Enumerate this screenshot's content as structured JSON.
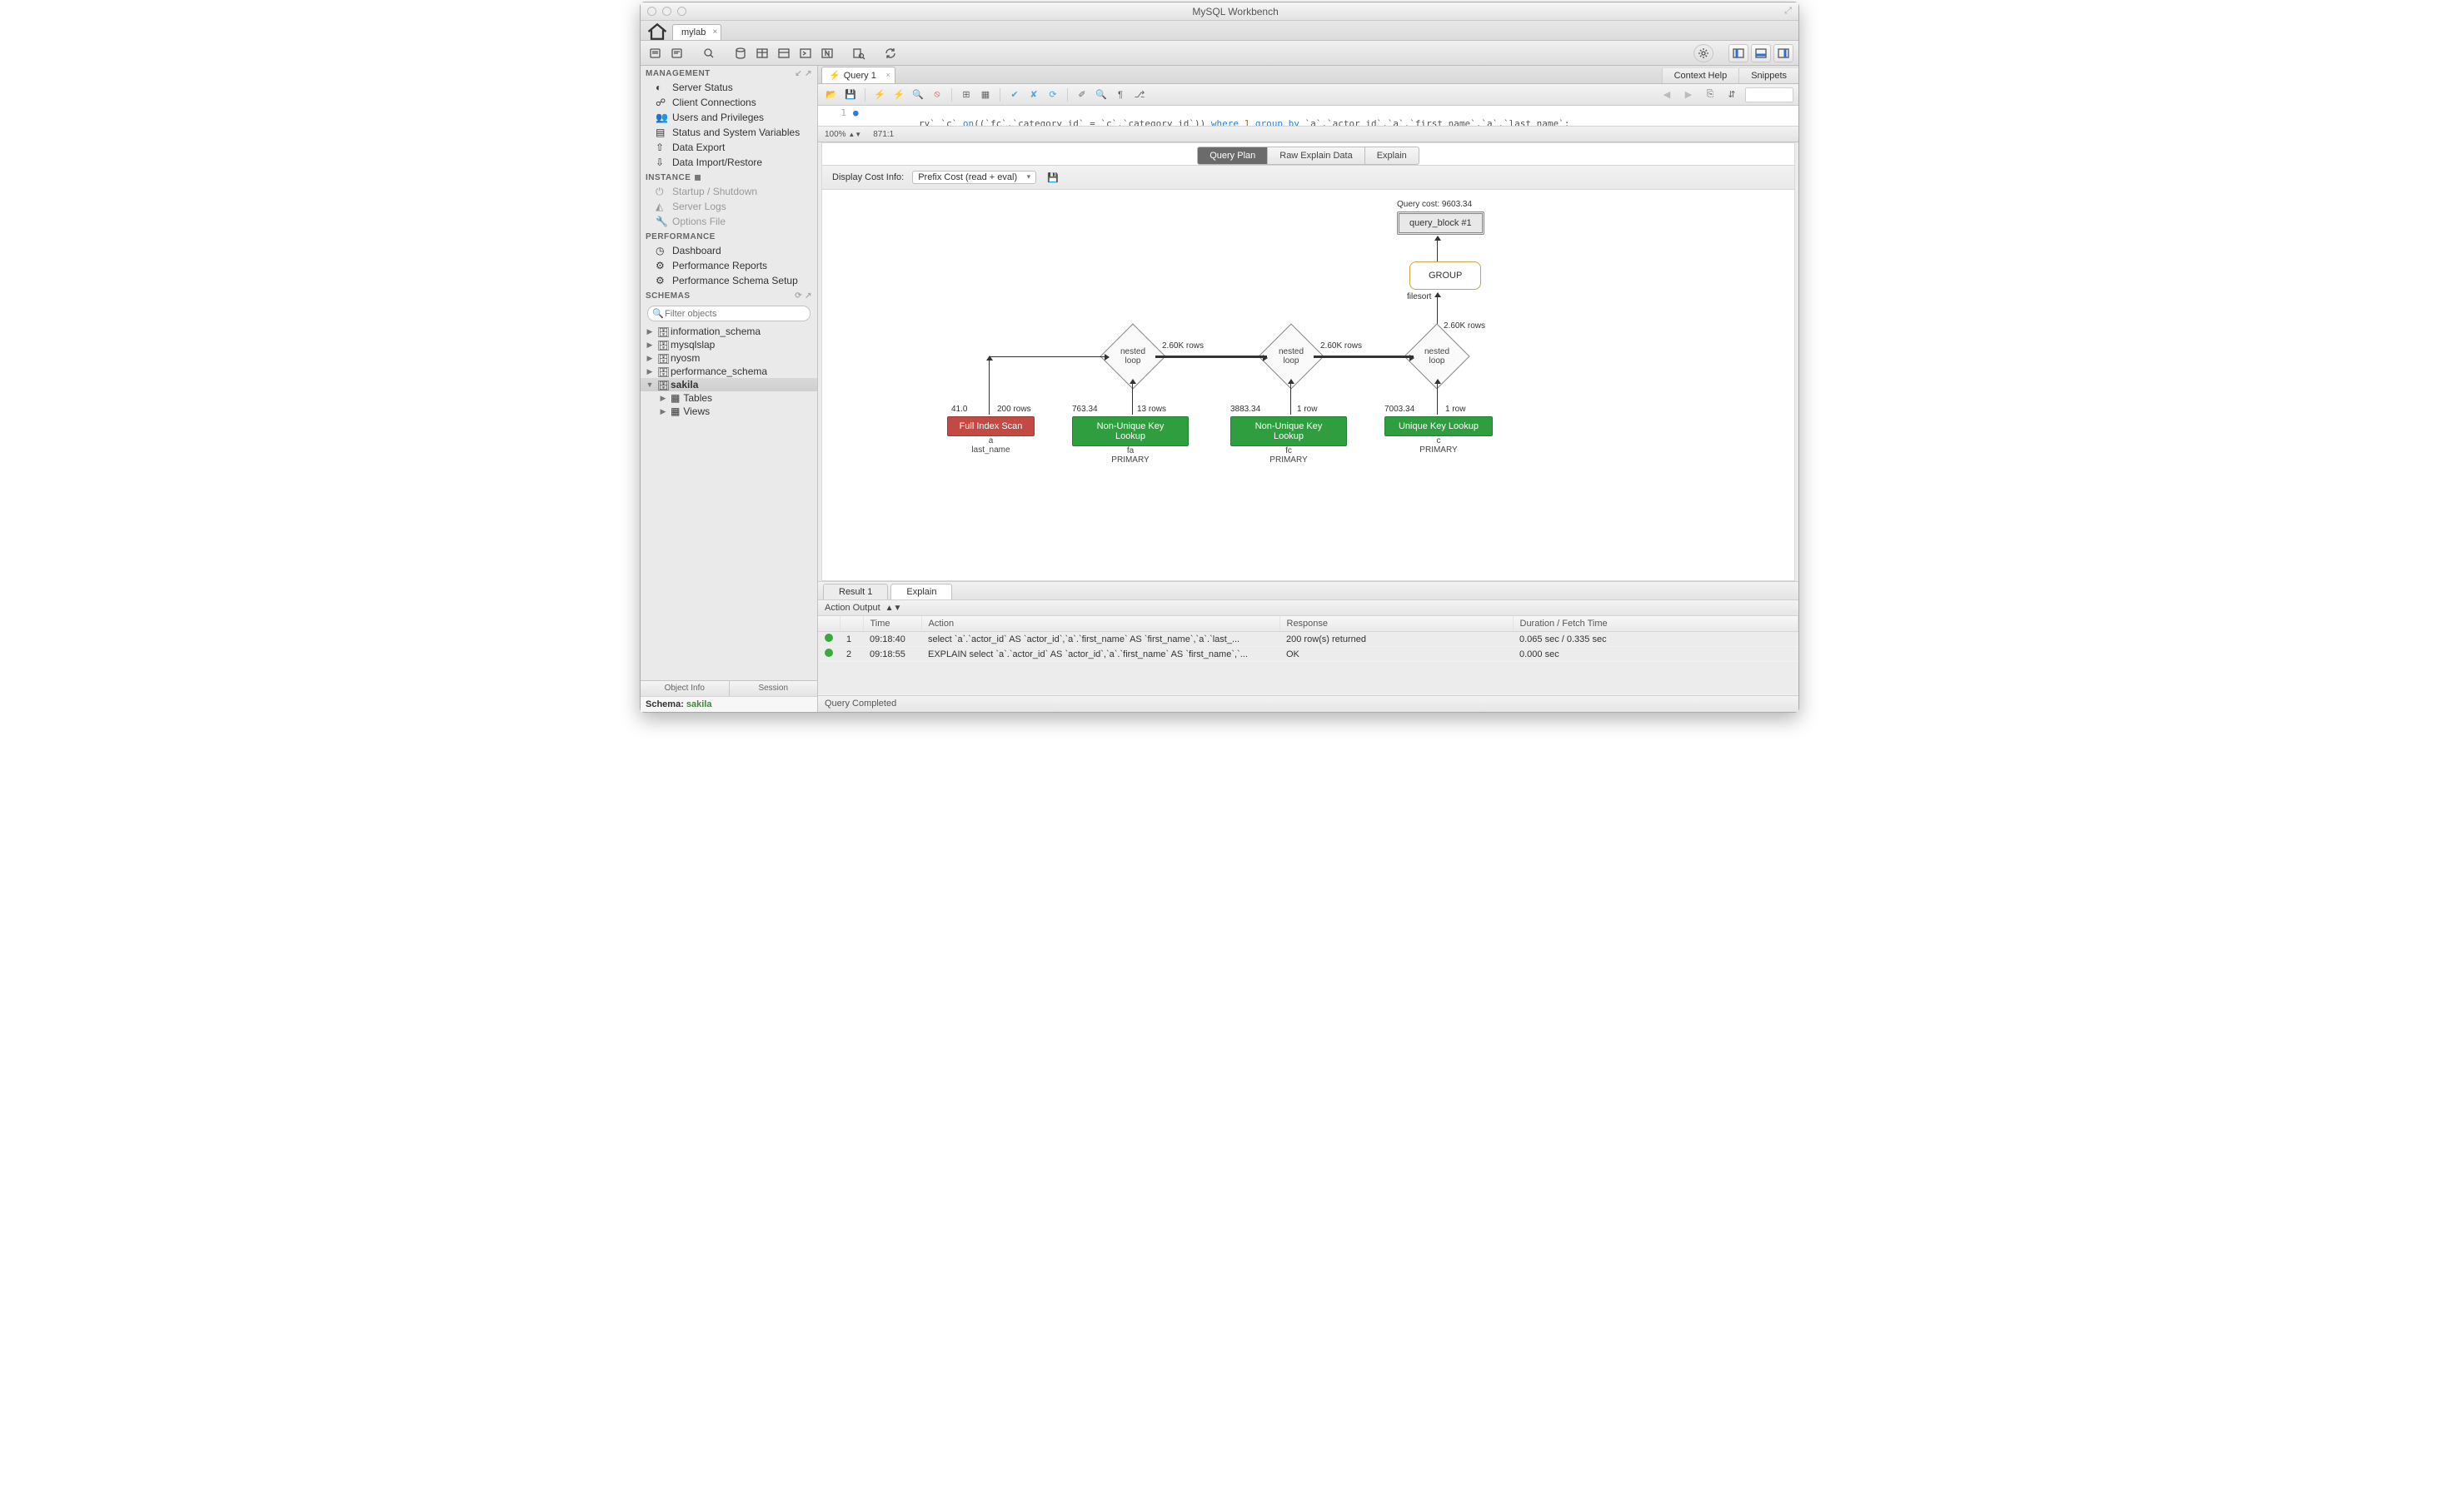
{
  "window": {
    "title": "MySQL Workbench"
  },
  "connection_tab": {
    "label": "mylab"
  },
  "sidebar": {
    "management_header": "MANAGEMENT",
    "management": [
      "Server Status",
      "Client Connections",
      "Users and Privileges",
      "Status and System Variables",
      "Data Export",
      "Data Import/Restore"
    ],
    "instance_header": "INSTANCE",
    "instance": [
      "Startup / Shutdown",
      "Server Logs",
      "Options File"
    ],
    "performance_header": "PERFORMANCE",
    "performance": [
      "Dashboard",
      "Performance Reports",
      "Performance Schema Setup"
    ],
    "schemas_header": "SCHEMAS",
    "filter_placeholder": "Filter objects",
    "schemas": [
      "information_schema",
      "mysqlslap",
      "nyosm",
      "performance_schema",
      "sakila"
    ],
    "sakila_children": [
      "Tables",
      "Views"
    ],
    "sub_tabs": {
      "left": "Object Info",
      "right": "Session"
    },
    "schema_label": "Schema:",
    "schema_value": "sakila"
  },
  "right_panel": {
    "context_help": "Context Help",
    "snippets": "Snippets"
  },
  "query_tab": {
    "label": "Query 1"
  },
  "editor": {
    "line_no": "1",
    "code_prefix": "ry` `c` ",
    "on": "on",
    "args": "((`fc`.`category_id` = `c`.`category_id`))",
    "where": " where ",
    "one": "1",
    "groupby": " group by ",
    "tail": "`a`.`actor_id`,`a`.`first_name`,`a`.`last_name`;",
    "zoom": "100%",
    "pos": "871:1"
  },
  "plan": {
    "tabs": [
      "Query Plan",
      "Raw Explain Data",
      "Explain"
    ],
    "cost_label": "Display Cost Info:",
    "cost_select": "Prefix Cost (read + eval)",
    "query_cost": "Query cost: 9603.34",
    "query_block": "query_block #1",
    "group": "GROUP",
    "filesort": "filesort",
    "rows_2_60k": "2.60K rows",
    "row_1": "1 row",
    "rows_13": "13 rows",
    "rows_200": "200 rows",
    "nested_loop": "nested\nloop",
    "n1": {
      "cost": "41.0",
      "rows": "200 rows",
      "op": "Full Index Scan",
      "tbl": "a",
      "key": "last_name"
    },
    "n2": {
      "cost": "763.34",
      "rows": "13 rows",
      "op": "Non-Unique Key Lookup",
      "tbl": "fa",
      "key": "PRIMARY"
    },
    "n3": {
      "cost": "3883.34",
      "rows": "1 row",
      "op": "Non-Unique Key Lookup",
      "tbl": "fc",
      "key": "PRIMARY"
    },
    "n4": {
      "cost": "7003.34",
      "rows": "1 row",
      "op": "Unique Key Lookup",
      "tbl": "c",
      "key": "PRIMARY"
    }
  },
  "result_tabs": {
    "result": "Result 1",
    "explain": "Explain"
  },
  "output": {
    "label": "Action Output",
    "columns": {
      "num": "",
      "time": "Time",
      "action": "Action",
      "response": "Response",
      "duration": "Duration / Fetch Time"
    },
    "rows": [
      {
        "n": "1",
        "time": "09:18:40",
        "action": "select `a`.`actor_id` AS `actor_id`,`a`.`first_name` AS `first_name`,`a`.`last_...",
        "response": "200 row(s) returned",
        "duration": "0.065 sec / 0.335 sec"
      },
      {
        "n": "2",
        "time": "09:18:55",
        "action": "EXPLAIN select `a`.`actor_id` AS `actor_id`,`a`.`first_name` AS `first_name`,`...",
        "response": "OK",
        "duration": "0.000 sec"
      }
    ]
  },
  "footer": {
    "status": "Query Completed"
  }
}
